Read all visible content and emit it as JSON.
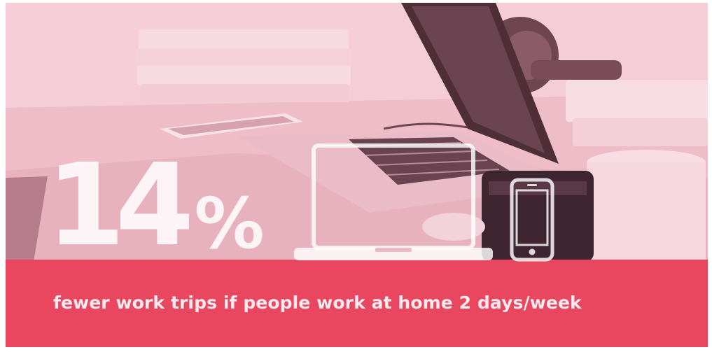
{
  "infographic": {
    "statistic": {
      "number": "14",
      "unit": "%"
    },
    "caption": "fewer work trips if people work at home 2 days/week",
    "icons": {
      "laptop": "laptop-icon",
      "phone": "smartphone-icon"
    },
    "photo": "desk-workspace-photo"
  },
  "colors": {
    "banner": "#e8475f",
    "tint": "#f3c4ce",
    "caption_text": "#fbe9ed",
    "statistic_text": "#ffffff"
  }
}
